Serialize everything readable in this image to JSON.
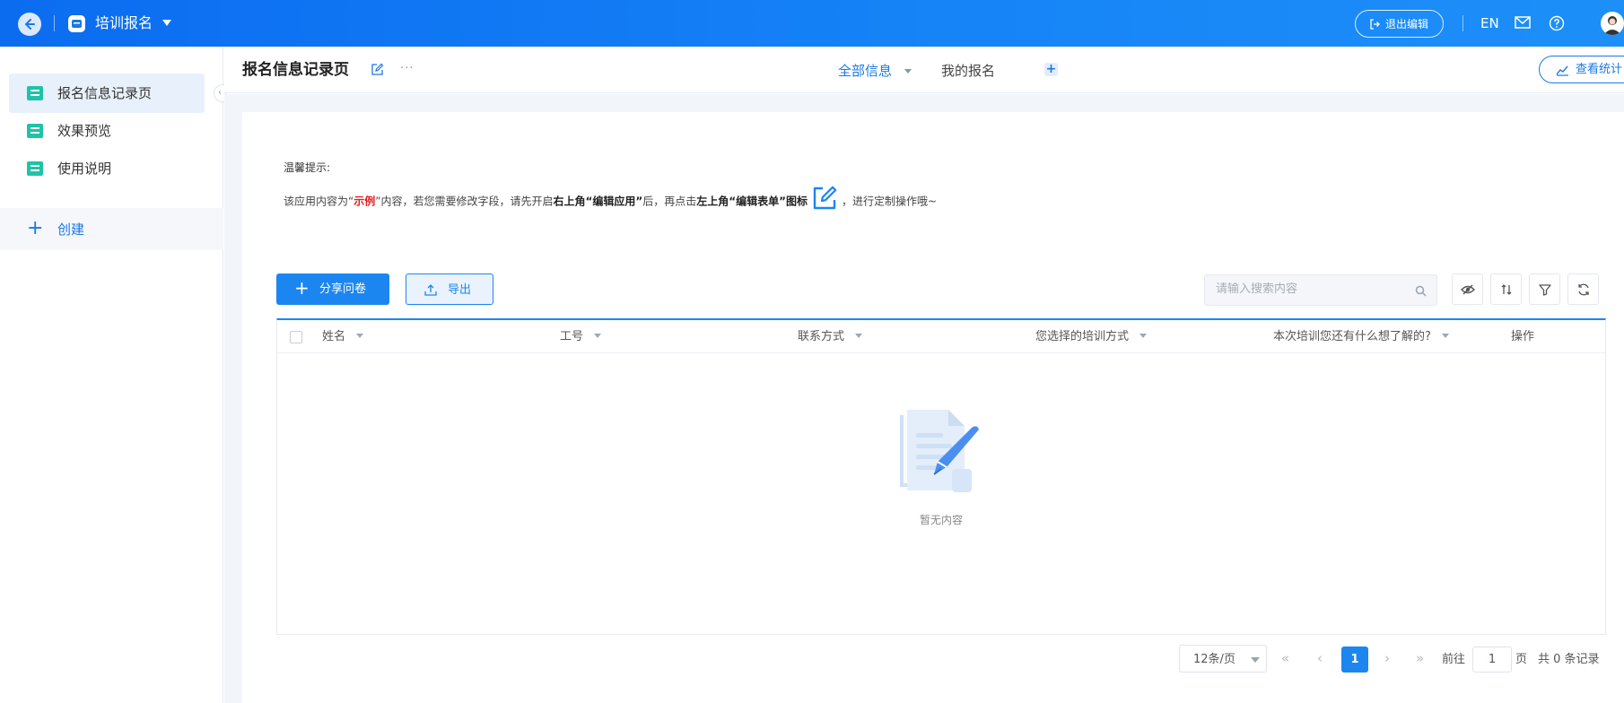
{
  "topbar": {
    "app_title": "培训报名",
    "exit_edit_label": "退出编辑",
    "lang_label": "EN",
    "icons": [
      "back-arrow-icon",
      "app-icon",
      "caret-down-icon",
      "exit-icon",
      "mail-icon",
      "help-icon",
      "avatar"
    ]
  },
  "sidebar": {
    "items": [
      {
        "label": "报名信息记录页",
        "active": true
      },
      {
        "label": "效果预览",
        "active": false
      },
      {
        "label": "使用说明",
        "active": false
      }
    ],
    "create_label": "创建",
    "accent_color": "#1ec3a8"
  },
  "page_header": {
    "title": "报名信息记录页",
    "tabs": [
      {
        "label": "全部信息",
        "active": true
      },
      {
        "label": "我的报名",
        "active": false
      }
    ],
    "stats_label": "查看统计"
  },
  "tip": {
    "title": "温馨提示:",
    "part1": "该应用内容为“",
    "example": "示例",
    "part2": "”内容，若您需要修改字段，请先开启",
    "bold1": "右上角“编辑应用”",
    "part3": "后，再点击",
    "bold2": "左上角“编辑表单”图标",
    "part4": "，进行定制操作哦~"
  },
  "toolbar": {
    "share_label": "分享问卷",
    "export_label": "导出",
    "search_placeholder": "请输入搜索内容"
  },
  "table": {
    "columns": [
      "姓名",
      "工号",
      "联系方式",
      "您选择的培训方式",
      "本次培训您还有什么想了解的?",
      "操作"
    ],
    "rows": [],
    "empty_text": "暂无内容"
  },
  "pagination": {
    "page_size": "12条/页",
    "current_page": "1",
    "goto_prefix": "前往",
    "goto_value": "1",
    "goto_suffix": "页",
    "total_text": "共 0 条记录"
  },
  "colors": {
    "primary": "#1b86f0",
    "topbar_gradient": [
      "#0b6cf0",
      "#1d8ff8"
    ],
    "red": "#e02020"
  }
}
